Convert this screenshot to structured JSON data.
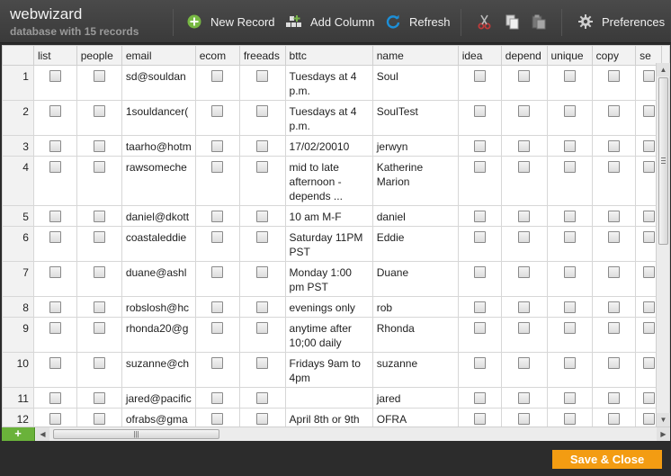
{
  "app": {
    "title": "webwizard",
    "subtitle": "database with 15 records"
  },
  "toolbar": {
    "new_record": "New Record",
    "add_column": "Add Column",
    "refresh": "Refresh",
    "preferences": "Preferences",
    "colors": {
      "new_record_icon": "#77b843",
      "add_column_icon": "#76b24a",
      "refresh_icon": "#1c8fd8",
      "cut_icon": "#c13a3a"
    }
  },
  "grid": {
    "columns": [
      "list",
      "people",
      "email",
      "ecom",
      "freeads",
      "bttc",
      "name",
      "idea",
      "depend",
      "unique",
      "copy",
      "se"
    ],
    "rows": [
      {
        "num": "1",
        "email": "sd@souldan",
        "bttc": "Tuesdays at 4 p.m.",
        "name": "Soul"
      },
      {
        "num": "2",
        "email": "1souldancer(",
        "bttc": "Tuesdays at 4 p.m.",
        "name": "SoulTest"
      },
      {
        "num": "3",
        "email": "taarho@hotm",
        "bttc": "17/02/20010",
        "name": "jerwyn"
      },
      {
        "num": "4",
        "email": "rawsomeche",
        "bttc": "mid to late afternoon - depends ...",
        "name": "Katherine Marion"
      },
      {
        "num": "5",
        "email": "daniel@dkott",
        "bttc": "10 am M-F",
        "name": "daniel"
      },
      {
        "num": "6",
        "email": "coastaleddie",
        "bttc": "Saturday 11PM PST",
        "name": "Eddie"
      },
      {
        "num": "7",
        "email": "duane@ashl",
        "bttc": "Monday 1:00 pm PST",
        "name": "Duane"
      },
      {
        "num": "8",
        "email": "robslosh@hc",
        "bttc": "evenings only",
        "name": "rob"
      },
      {
        "num": "9",
        "email": "rhonda20@g",
        "bttc": "anytime after 10;00 daily",
        "name": "Rhonda"
      },
      {
        "num": "10",
        "email": "suzanne@ch",
        "bttc": "Fridays 9am to 4pm",
        "name": "suzanne"
      },
      {
        "num": "11",
        "email": "jared@pacific",
        "bttc": "",
        "name": "jared"
      },
      {
        "num": "12",
        "email": "ofrabs@gma",
        "bttc": "April 8th or 9th",
        "name": "OFRA"
      }
    ]
  },
  "footer": {
    "save_close": "Save & Close",
    "accent": "#f39c12"
  },
  "add_row_symbol": "+",
  "scroll_grip": "|||"
}
